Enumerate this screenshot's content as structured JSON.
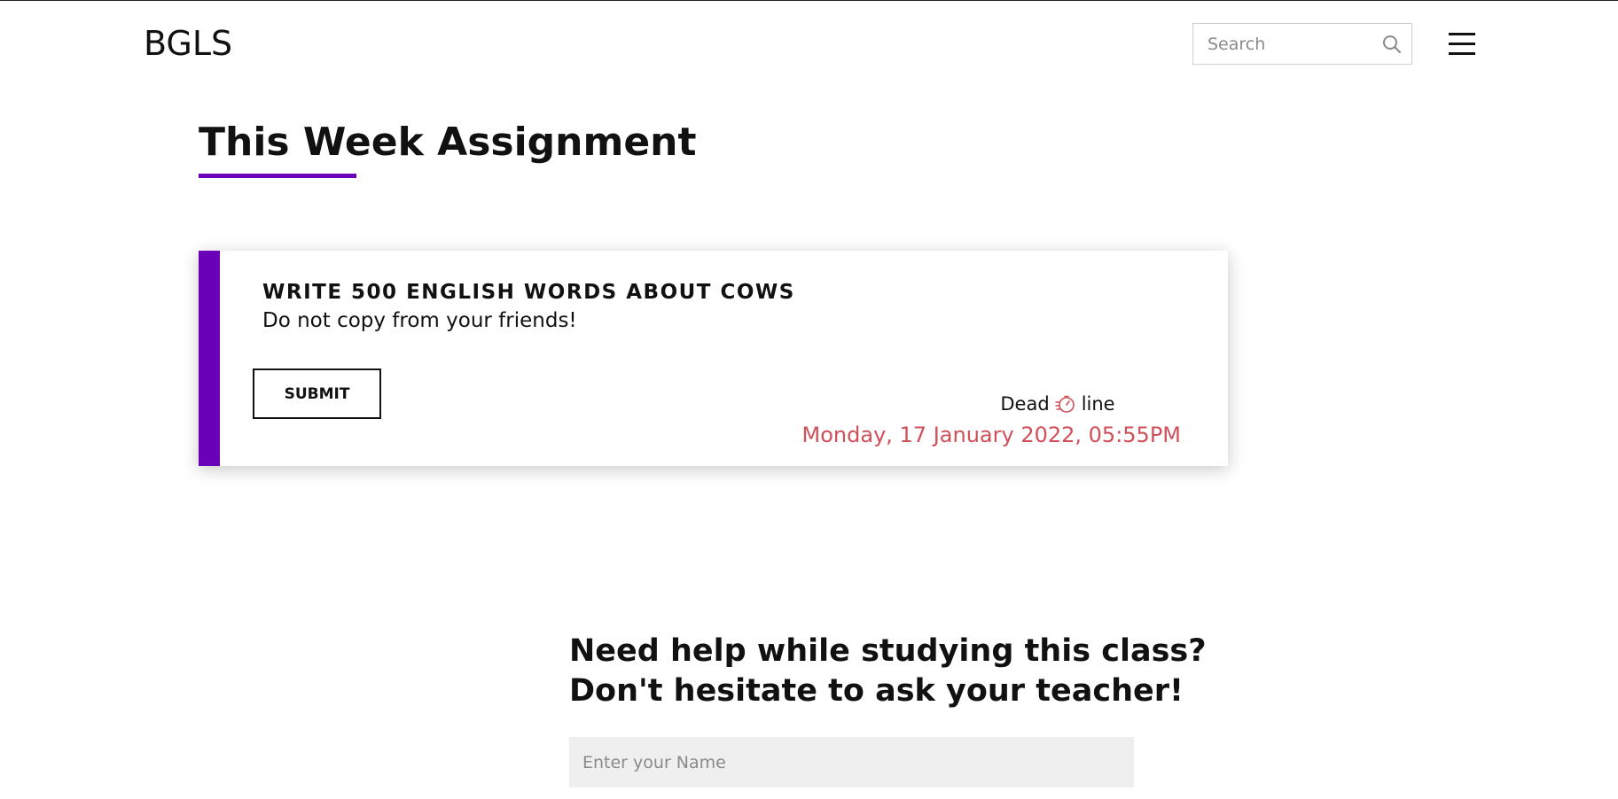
{
  "header": {
    "logo": "BGLS",
    "search_placeholder": "Search",
    "search_icon": "search-icon",
    "menu_icon": "hamburger-menu-icon"
  },
  "main": {
    "title": "This Week Assignment",
    "accent_color": "#6a00b8",
    "assignment": {
      "title": "WRITE 500 ENGLISH WORDS ABOUT COWS",
      "subtitle": "Do not copy from your friends!",
      "submit_label": "SUBMIT",
      "deadline_prefix": "Dead",
      "deadline_suffix": "line",
      "deadline_icon": "timer-icon",
      "deadline_date": "Monday, 17 January 2022, 05:55PM",
      "deadline_color": "#d0505a"
    }
  },
  "help": {
    "heading_line1": "Need help while studying this class?",
    "heading_line2": "Don't hesitate to ask your teacher!",
    "name_placeholder": "Enter your Name"
  }
}
